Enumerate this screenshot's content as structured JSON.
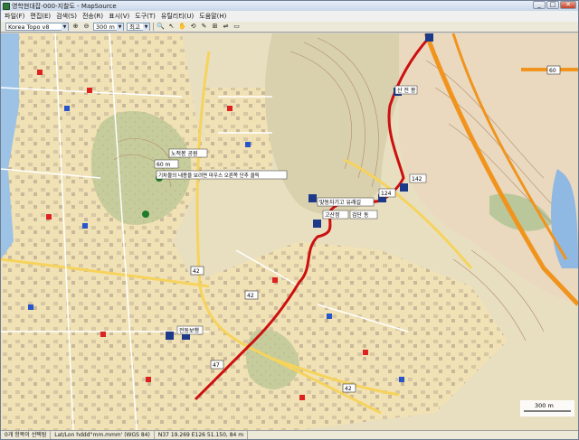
{
  "window": {
    "title": "영학현대잡-000-지찰도 - MapSource",
    "btn_min": "_",
    "btn_max": "□",
    "btn_close": "✕"
  },
  "menu": [
    "파일(F)",
    "편집(E)",
    "검색(S)",
    "전송(R)",
    "표시(V)",
    "도구(T)",
    "유틸리티(U)",
    "도움말(H)"
  ],
  "toolbar": {
    "product": "Korea Topo v8",
    "zoom": "300 m",
    "detail": "최고",
    "tools": [
      "🔍",
      "⊕",
      "⊖",
      "↖",
      "✋",
      "⟲",
      "✎",
      "⊞",
      "⇌",
      "▭"
    ]
  },
  "map": {
    "waypoints": [
      {
        "label": "노적봉 공원"
      },
      {
        "label": "60 m"
      },
      {
        "label": "기차물의 내용을 보려면 마우스 오른쪽 단추 클릭"
      },
      {
        "label": "맞동자기고 유래길"
      },
      {
        "label": "고산정"
      },
      {
        "label": "검단 동"
      },
      {
        "label": "전동보행"
      },
      {
        "label": "산 전 봉"
      },
      {
        "label": "142"
      },
      {
        "label": "124"
      }
    ],
    "road_numbers": [
      "42",
      "42",
      "47",
      "42",
      "60"
    ],
    "scale_label": "300 m",
    "colors": {
      "track": "#cc1010",
      "expressway": "#f0941d",
      "urban": "#f3e3b8",
      "forest": "#c9cf9e",
      "water": "#8fb8e2",
      "contour": "#b08d6a"
    }
  },
  "status": {
    "selection": "0개 항목이 선택됨",
    "format": "Lat/Lon hddd°mm.mmm' (WGS 84)",
    "coords": "N37 19.269 E126 51.150, 84 m"
  }
}
